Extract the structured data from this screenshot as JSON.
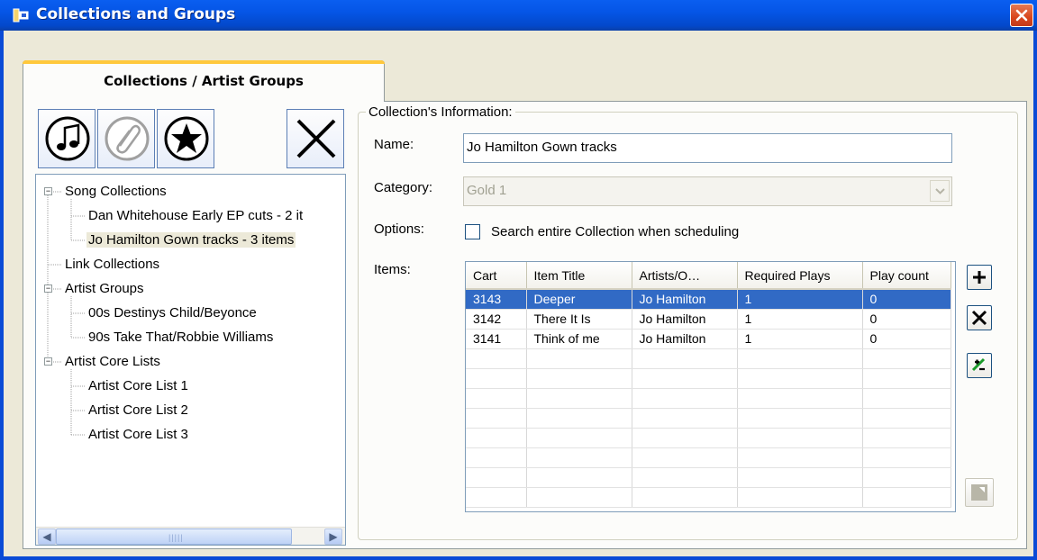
{
  "window": {
    "title": "Collections and Groups"
  },
  "tab": {
    "label": "Collections / Artist Groups"
  },
  "toolbar": {
    "song_collection_icon": "music-note-icon",
    "link_collection_icon": "paperclip-icon",
    "artist_group_icon": "star-icon",
    "delete_icon": "close-icon"
  },
  "tree": {
    "nodes": [
      {
        "label": "Song Collections",
        "level": 0,
        "expander": "−"
      },
      {
        "label": "Dan Whitehouse Early EP cuts - 2 it",
        "level": 1
      },
      {
        "label": "Jo Hamilton Gown tracks - 3 items",
        "level": 1,
        "selected": true
      },
      {
        "label": "Link Collections",
        "level": 0
      },
      {
        "label": "Artist Groups",
        "level": 0,
        "expander": "−"
      },
      {
        "label": "00s Destinys Child/Beyonce",
        "level": 1
      },
      {
        "label": "90s Take That/Robbie Williams",
        "level": 1
      },
      {
        "label": "Artist Core Lists",
        "level": 0,
        "expander": "−"
      },
      {
        "label": "Artist Core List 1",
        "level": 1
      },
      {
        "label": "Artist Core List 2",
        "level": 1
      },
      {
        "label": "Artist Core List 3",
        "level": 1
      }
    ]
  },
  "info": {
    "legend": "Collection's Information:",
    "name_label": "Name:",
    "name_value": "Jo Hamilton Gown tracks",
    "category_label": "Category:",
    "category_value": "Gold 1",
    "options_label": "Options:",
    "option_search": "Search entire Collection when scheduling",
    "items_label": "Items:"
  },
  "items": {
    "columns": [
      "Cart",
      "Item Title",
      "Artists/O…",
      "Required Plays",
      "Play count"
    ],
    "rows": [
      [
        "3143",
        "Deeper",
        "Jo Hamilton",
        "1",
        "0"
      ],
      [
        "3142",
        "There It Is",
        "Jo Hamilton",
        "1",
        "0"
      ],
      [
        "3141",
        "Think of me",
        "Jo Hamilton",
        "1",
        "0"
      ]
    ],
    "selected_row": 0
  },
  "colors": {
    "titlebar": "#0a5ef0",
    "selection": "#316ac5",
    "close": "#d8461d"
  }
}
